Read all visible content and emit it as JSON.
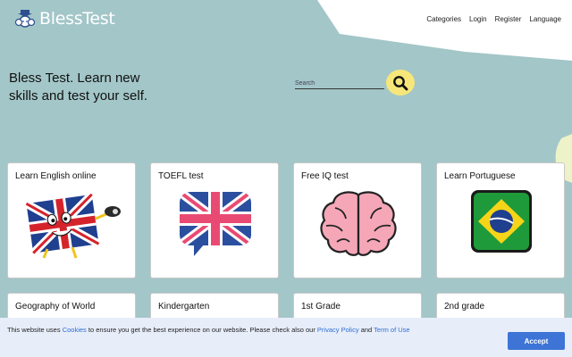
{
  "header": {
    "logo_text": "BlessTest",
    "nav": [
      "Categories",
      "Login",
      "Register",
      "Language"
    ]
  },
  "hero": {
    "text": "Bless Test. Learn new skills and test your self."
  },
  "search": {
    "placeholder": "Search"
  },
  "cards": [
    {
      "title": "Learn English online",
      "icon": "uk-flag-mascot-icon"
    },
    {
      "title": "TOEFL test",
      "icon": "uk-flag-speech-bubble-icon"
    },
    {
      "title": "Free IQ test",
      "icon": "brain-icon"
    },
    {
      "title": "Learn Portuguese",
      "icon": "brazil-flag-icon"
    },
    {
      "title": "Geography of World",
      "icon": ""
    },
    {
      "title": "Kindergarten",
      "icon": ""
    },
    {
      "title": "1st Grade",
      "icon": ""
    },
    {
      "title": "2nd grade",
      "icon": ""
    }
  ],
  "cookie": {
    "pre": "This website uses",
    "cookies_link": "Cookies",
    "mid": "to ensure you get the best experience on our website. Please check also our",
    "privacy_link": "Privacy Policy",
    "and": "and",
    "terms_link": "Term of Use",
    "accept_label": "Accept"
  },
  "colors": {
    "background": "#a3c6c8",
    "accent_yellow": "#f7e77a",
    "accept_blue": "#3d74d6",
    "link_blue": "#2f6fd6"
  }
}
